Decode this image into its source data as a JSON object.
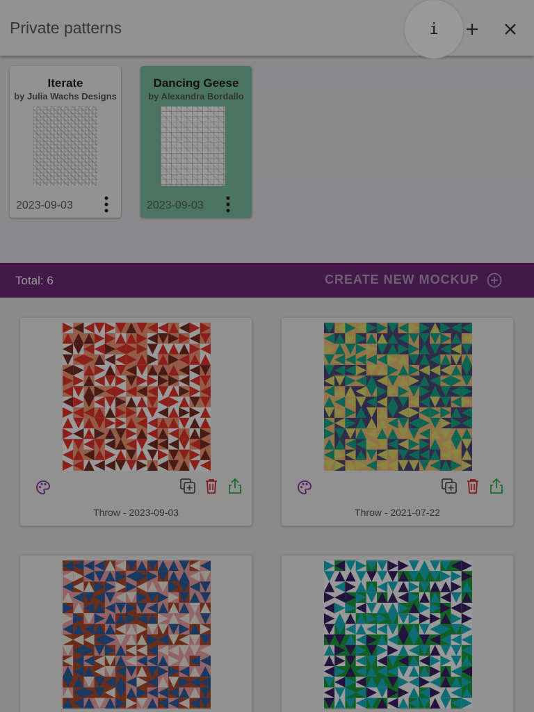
{
  "header": {
    "title": "Private patterns",
    "info_label": "i",
    "icons": [
      "info-icon",
      "plus-icon",
      "close-icon"
    ]
  },
  "patterns": [
    {
      "name": "Iterate",
      "author": "by Julia Wachs Designs",
      "date": "2023-09-03",
      "background": "#f4f4f5"
    },
    {
      "name": "Dancing Geese",
      "author": "by Alexandra Bordallo",
      "date": "2023-09-03",
      "background": "#7ec2a6"
    }
  ],
  "mockups_bar": {
    "total": "Total: 6",
    "create_label": "CREATE NEW MOCKUP",
    "background": "#6e2a78"
  },
  "mockups": [
    {
      "label": "Throw - 2023-09-03",
      "colors": [
        "#e8342a",
        "#f59a7b",
        "#7a2e24",
        "#ffffff"
      ]
    },
    {
      "label": "Throw - 2021-07-22",
      "colors": [
        "#1aa88a",
        "#f6c27a",
        "#e3e06e",
        "#4d4a7a"
      ]
    },
    {
      "label": "",
      "colors": [
        "#2e5fa1",
        "#f4a6a8",
        "#f8f1e4",
        "#b14c2a"
      ]
    },
    {
      "label": "",
      "colors": [
        "#16b5c2",
        "#1f9e3e",
        "#3a2266",
        "#ffffff"
      ]
    }
  ],
  "action_colors": {
    "palette": "#8e2fa2",
    "duplicate": "#555555",
    "delete": "#e22a2a",
    "share": "#2fb04a"
  }
}
